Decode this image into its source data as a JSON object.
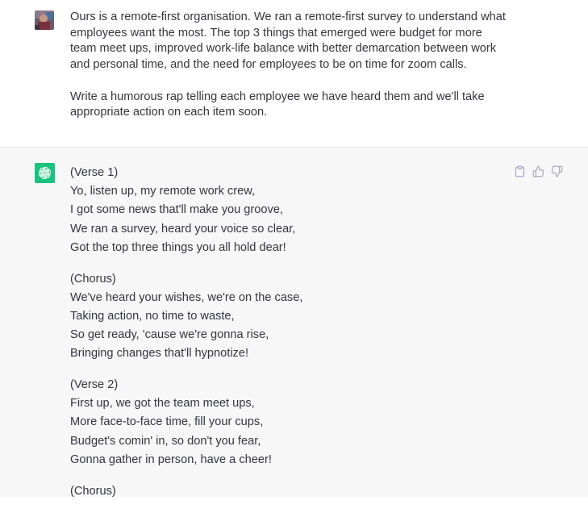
{
  "user_message": {
    "paragraphs": [
      "Ours is a remote-first organisation. We ran a remote-first survey to understand what employees want the most. The top 3 things that emerged were budget for more team meet ups, improved work-life balance with better demarcation between work and personal time, and the need for employees to be on time for zoom calls.",
      "Write a humorous rap telling each employee we have heard them and we'll take appropriate action on each item soon."
    ]
  },
  "assistant_message": {
    "stanzas": [
      {
        "heading": "(Verse 1)",
        "lines": [
          "Yo, listen up, my remote work crew,",
          "I got some news that'll make you groove,",
          "We ran a survey, heard your voice so clear,",
          "Got the top three things you all hold dear!"
        ]
      },
      {
        "heading": "(Chorus)",
        "lines": [
          "We've heard your wishes, we're on the case,",
          "Taking action, no time to waste,",
          "So get ready, 'cause we're gonna rise,",
          "Bringing changes that'll hypnotize!"
        ]
      },
      {
        "heading": "(Verse 2)",
        "lines": [
          "First up, we got the team meet ups,",
          "More face-to-face time, fill your cups,",
          "Budget's comin' in, so don't you fear,",
          "Gonna gather in person, have a cheer!"
        ]
      },
      {
        "heading": "(Chorus)",
        "lines": []
      }
    ]
  },
  "icons": {
    "user_avatar": "user-avatar",
    "assistant_avatar": "openai-logo-icon",
    "copy": "clipboard-icon",
    "like": "thumbs-up-icon",
    "dislike": "thumbs-down-icon"
  },
  "colors": {
    "assistant_avatar_bg": "#19c37d",
    "assistant_bg": "#f7f7f8",
    "text": "#343541",
    "icon": "#acacbe"
  }
}
